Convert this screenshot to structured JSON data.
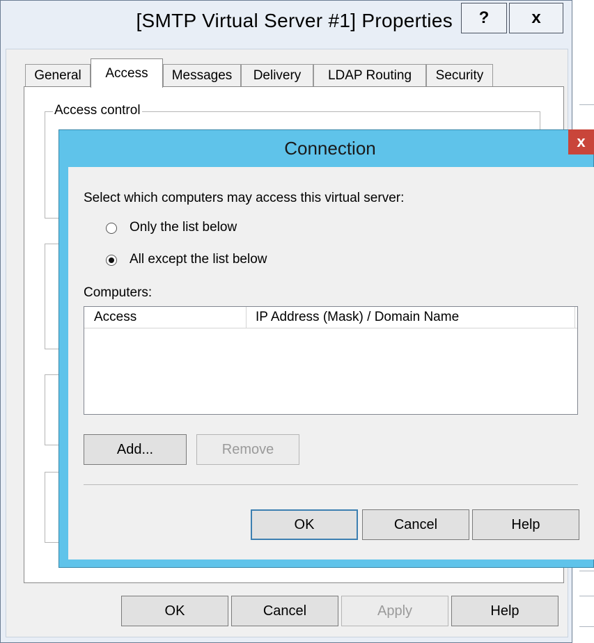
{
  "outer_window": {
    "title": "[SMTP Virtual Server #1] Properties",
    "help_caption": "?",
    "close_caption": "x",
    "tabs": [
      {
        "label": "General",
        "active": false
      },
      {
        "label": "Access",
        "active": true
      },
      {
        "label": "Messages",
        "active": false
      },
      {
        "label": "Delivery",
        "active": false
      },
      {
        "label": "LDAP Routing",
        "active": false
      },
      {
        "label": "Security",
        "active": false
      }
    ],
    "group_access_control": "Access control",
    "buttons": {
      "ok": "OK",
      "cancel": "Cancel",
      "apply": "Apply",
      "help": "Help"
    }
  },
  "dialog": {
    "title": "Connection",
    "close_caption": "x",
    "prompt": "Select which computers may access this virtual server:",
    "radio_options": [
      {
        "label": "Only the list below",
        "checked": false
      },
      {
        "label": "All except the list below",
        "checked": true
      }
    ],
    "computers_label": "Computers:",
    "list_columns": [
      "Access",
      "IP Address (Mask) / Domain Name"
    ],
    "list_rows": [],
    "add_button": "Add...",
    "remove_button": "Remove",
    "ok_button": "OK",
    "cancel_button": "Cancel",
    "help_button": "Help"
  },
  "colors": {
    "dialog_frame": "#5fc3ea",
    "close_button": "#c9453a"
  }
}
